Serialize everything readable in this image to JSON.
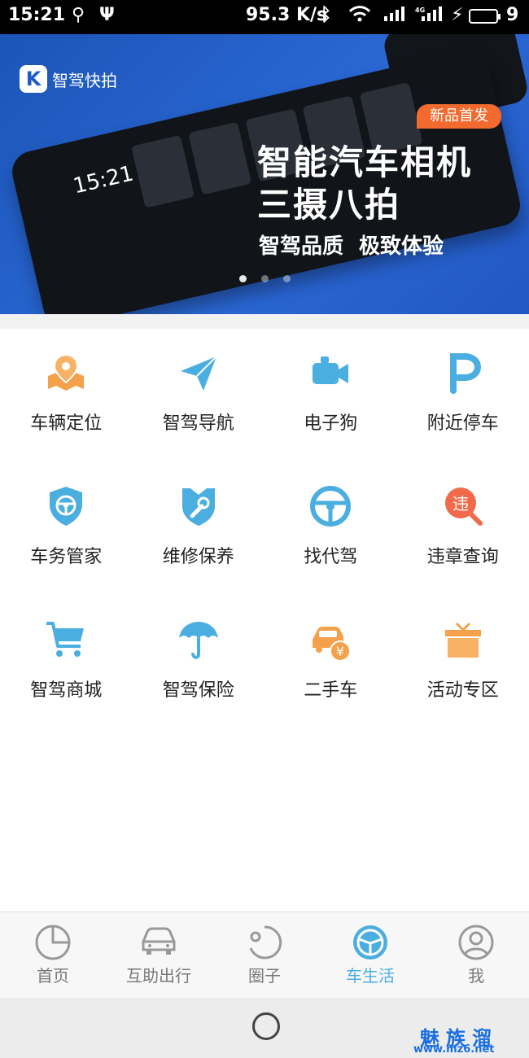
{
  "status_bar": {
    "time": "15:21",
    "speed": "95.3 K/s",
    "battery": "9",
    "network_label": "4G"
  },
  "banner": {
    "logo_text": "智驾快拍",
    "tag": "新品首发",
    "headline_1": "智能汽车相机",
    "headline_2": "三摄八拍",
    "slogan": "智驾品质 极致体验",
    "device_time": "15:21",
    "page_count": 3,
    "active_page": 1
  },
  "grid": [
    {
      "label": "车辆定位",
      "icon": "map-pin-icon",
      "color": "#f5a04a"
    },
    {
      "label": "智驾导航",
      "icon": "paper-plane-icon",
      "color": "#4aaee0"
    },
    {
      "label": "电子狗",
      "icon": "camera-icon",
      "color": "#4aaee0"
    },
    {
      "label": "附近停车",
      "icon": "parking-icon",
      "color": "#4aaee0"
    },
    {
      "label": "车务管家",
      "icon": "shield-wheel-icon",
      "color": "#4aaee0"
    },
    {
      "label": "维修保养",
      "icon": "wrench-shield-icon",
      "color": "#4aaee0"
    },
    {
      "label": "找代驾",
      "icon": "steering-wheel-icon",
      "color": "#4aaee0"
    },
    {
      "label": "违章查询",
      "icon": "violation-search-icon",
      "color": "#f26a4a"
    },
    {
      "label": "智驾商城",
      "icon": "cart-icon",
      "color": "#4aaee0"
    },
    {
      "label": "智驾保险",
      "icon": "umbrella-icon",
      "color": "#4aaee0"
    },
    {
      "label": "二手车",
      "icon": "car-yen-icon",
      "color": "#f5a04a"
    },
    {
      "label": "活动专区",
      "icon": "gift-icon",
      "color": "#f5a04a"
    }
  ],
  "tabs": [
    {
      "label": "首页",
      "icon": "pie-chart-icon"
    },
    {
      "label": "互助出行",
      "icon": "car-icon"
    },
    {
      "label": "圈子",
      "icon": "circle-icon"
    },
    {
      "label": "车生活",
      "icon": "steering-wheel-icon",
      "active": true
    },
    {
      "label": "我",
      "icon": "user-icon"
    }
  ],
  "watermark": {
    "name": "魅族溜",
    "site": "www.mz6.net"
  },
  "colors": {
    "accent": "#4aaee0",
    "orange": "#f5a04a",
    "red": "#f26a4a",
    "banner_blue": "#2b69d6"
  }
}
